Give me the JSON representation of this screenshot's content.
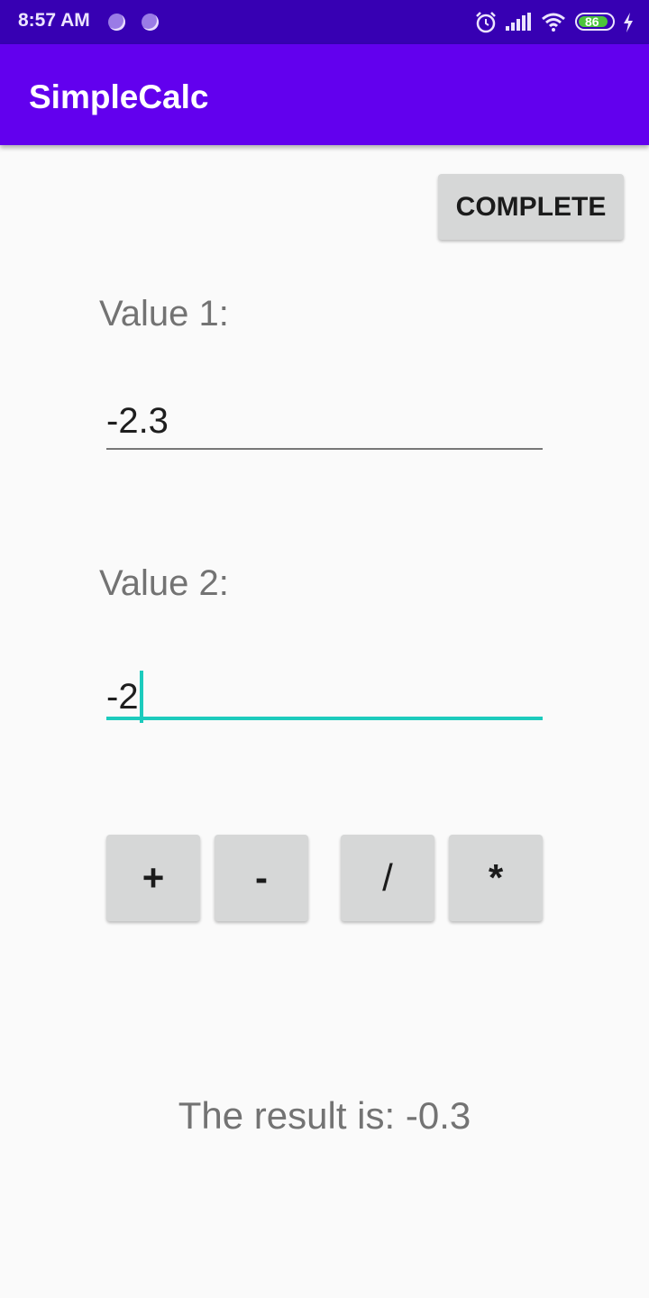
{
  "status_bar": {
    "time": "8:57 AM",
    "battery": "86",
    "icons": [
      "notification-dot-icon",
      "notification-dot-icon",
      "alarm-icon",
      "signal-icon",
      "wifi-icon",
      "battery-icon",
      "charging-icon"
    ]
  },
  "app_bar": {
    "title": "SimpleCalc"
  },
  "complete_button": {
    "label": "COMPLETE"
  },
  "value1": {
    "label": "Value 1:",
    "value": "-2.3"
  },
  "value2": {
    "label": "Value 2:",
    "value": "-2"
  },
  "operations": [
    {
      "label": "+",
      "name": "add-button"
    },
    {
      "label": "-",
      "name": "subtract-button"
    },
    {
      "label": "/",
      "name": "divide-button"
    },
    {
      "label": "*",
      "name": "multiply-button"
    }
  ],
  "result": {
    "text": "The result is: -0.3"
  },
  "colors": {
    "status_bar": "#3700b3",
    "app_bar": "#6200ee",
    "accent": "#1ccbbd",
    "background": "#fafafa"
  }
}
